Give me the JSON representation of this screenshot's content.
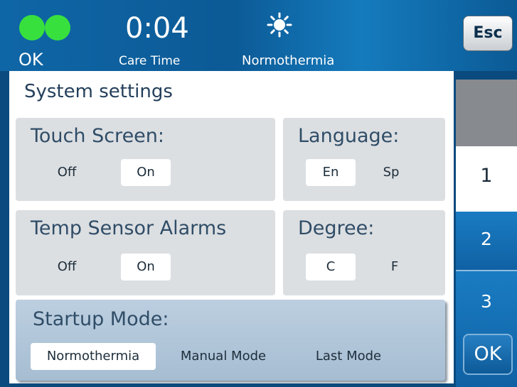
{
  "header": {
    "status": "OK",
    "time": "0:04",
    "time_label": "Care Time",
    "mode": "Normothermia",
    "esc_label": "Esc"
  },
  "panel": {
    "title": "System settings",
    "touch_screen": {
      "label": "Touch Screen:",
      "options": [
        "Off",
        "On"
      ],
      "selected": "On"
    },
    "language": {
      "label": "Language:",
      "options": [
        "En",
        "Sp"
      ],
      "selected": "En"
    },
    "temp_sensor_alarms": {
      "label": "Temp Sensor Alarms",
      "options": [
        "Off",
        "On"
      ],
      "selected": "On"
    },
    "degree": {
      "label": "Degree:",
      "options": [
        "C",
        "F"
      ],
      "selected": "C"
    },
    "startup_mode": {
      "label": "Startup Mode:",
      "options": [
        "Normothermia",
        "Manual Mode",
        "Last Mode"
      ],
      "selected": "Normothermia"
    }
  },
  "tabs": [
    "1",
    "2",
    "3"
  ],
  "ok_button": "OK",
  "colors": {
    "status_green": "#38e03e",
    "header_blue": "#0f66a6",
    "tab_blue": "#1a7cc3",
    "setting_box": "#dcdfe2"
  },
  "icons": {
    "status": "status-dots-icon",
    "mode": "sun-icon"
  }
}
